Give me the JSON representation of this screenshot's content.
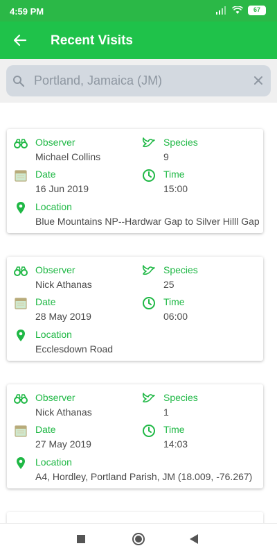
{
  "status_bar": {
    "time": "4:59 PM",
    "battery": "67"
  },
  "app_bar": {
    "title": "Recent Visits",
    "back_icon": "arrow-back-icon"
  },
  "search": {
    "value": "",
    "placeholder": "Portland, Jamaica (JM)"
  },
  "labels": {
    "observer": "Observer",
    "species": "Species",
    "date": "Date",
    "time": "Time",
    "location": "Location"
  },
  "visits": [
    {
      "observer": "Michael Collins",
      "species": "9",
      "date": "16 Jun 2019",
      "time": "15:00",
      "location": "Blue Mountains NP--Hardwar Gap to Silver Hilll Gap"
    },
    {
      "observer": "Nick Athanas",
      "species": "25",
      "date": "28 May 2019",
      "time": "06:00",
      "location": "Ecclesdown Road"
    },
    {
      "observer": "Nick Athanas",
      "species": "1",
      "date": "27 May 2019",
      "time": "14:03",
      "location": "A4, Hordley, Portland Parish, JM (18.009, -76.267)"
    }
  ],
  "colors": {
    "status_bar": "#2bb847",
    "app_bar": "#1fc24a",
    "accent": "#1fb845",
    "value_text": "#4a4a4a",
    "search_box": "#d3d9e0"
  }
}
